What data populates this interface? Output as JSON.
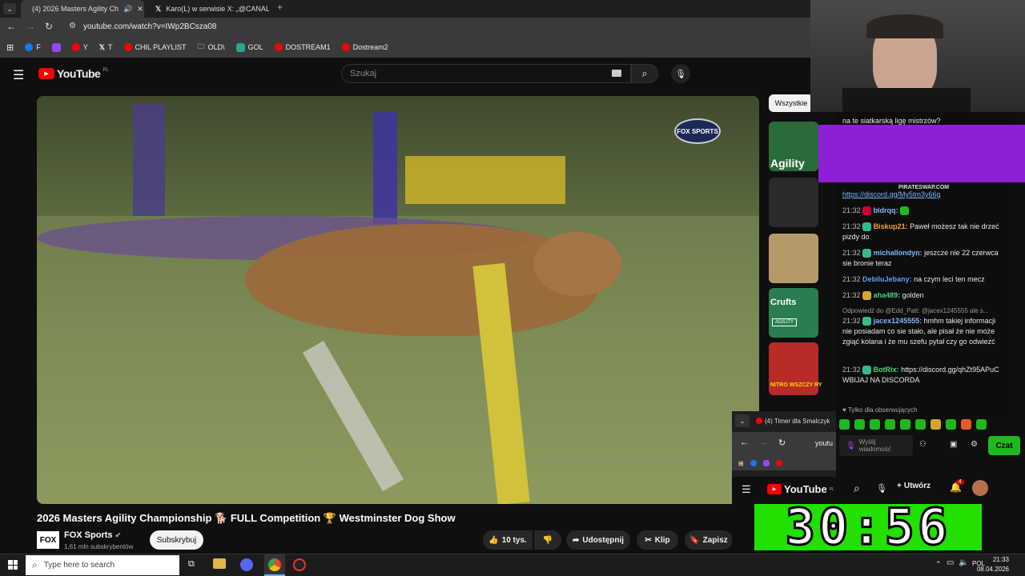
{
  "tabs": [
    {
      "label": "(4) 2026 Masters Agility Ch",
      "active": true
    },
    {
      "label": "Karo(L) w serwisie X: „@CANAL",
      "active": false
    }
  ],
  "url": "youtube.com/watch?v=IWp2BCsza08",
  "bookmarks": [
    "F",
    "Y",
    "T",
    "CHIL PLAYLIST",
    "OLD\\",
    "GOL",
    "DOSTREAM1",
    "Dostream2"
  ],
  "youtube": {
    "logo": "YouTube",
    "logo_region": "PL",
    "search_placeholder": "Szukaj"
  },
  "video": {
    "title": "2026 Masters Agility Championship 🐕 FULL Competition 🏆 Westminster Dog Show",
    "broadcaster_badge": "FOX SPORTS"
  },
  "channel": {
    "logo": "FOX",
    "name": "FOX Sports",
    "subscribers": "1,61 mln subskrybentów",
    "subscribe_label": "Subskrybuj"
  },
  "actions": {
    "likes": "10 tys.",
    "share": "Udostępnij",
    "clip": "Klip",
    "save": "Zapisz"
  },
  "sidebar": {
    "filter_chip": "Wszystkie",
    "thumb_labels": [
      "Agility",
      "Crufts",
      "AGILITY",
      "NITRO WSZCZY RY"
    ]
  },
  "chat": {
    "banner_text": "PIRATESWAP.COM",
    "top_message": "na te siatkarską ligę mistrzów?",
    "messages": [
      {
        "time": "",
        "user": "",
        "text": "https://discord.gg/My5tm3y66g"
      },
      {
        "time": "21:32",
        "user": "bldrqq:",
        "text": ""
      },
      {
        "time": "21:32",
        "user": "Biskup21:",
        "text": "Paweł możesz tak nie drzeć pizdy do"
      },
      {
        "time": "21:32",
        "user": "michallondyn:",
        "text": "jeszcze nie 22 czerwca sie bronie teraz"
      },
      {
        "time": "21:32",
        "user": "DebiluJebany:",
        "text": "na czym leci ten mecz"
      },
      {
        "time": "21:32",
        "user": "aha489:",
        "text": "golden"
      },
      {
        "time": "",
        "user": "",
        "text": "Odpowiedź do @Edd_Patt: @jacex1245555 ale s..."
      },
      {
        "time": "21:32",
        "user": "jacex1245555:",
        "text": "hmhm takiej informacji nie posiadam co sie stało, ale pisał że nie może zgiąć kolana i że mu szefu pytał czy go odwiezć"
      },
      {
        "time": "21:32",
        "user": "BotRix:",
        "text": "https://discord.gg/qhZt95APuC WBIJAJ NA DISCORDA"
      }
    ],
    "followers_only": "Tylko dla obserwujących",
    "input_placeholder": "Wyślij wiadomość",
    "send_label": "Czat"
  },
  "popup": {
    "tab_label": "(4) Timer dla Smalczyk",
    "url_fragment": "youtu",
    "create_label": "Utwórz",
    "notif_count": "4",
    "timer_text": "30:56"
  },
  "taskbar": {
    "search_placeholder": "Type here to search",
    "language": "POL",
    "time": "21:33",
    "date": "08.04.2026"
  },
  "colors": {
    "youtube_red": "#ff0000",
    "chat_green": "#1db91d",
    "timer_green": "#22e000",
    "kick_purple": "#8e1fd6"
  }
}
